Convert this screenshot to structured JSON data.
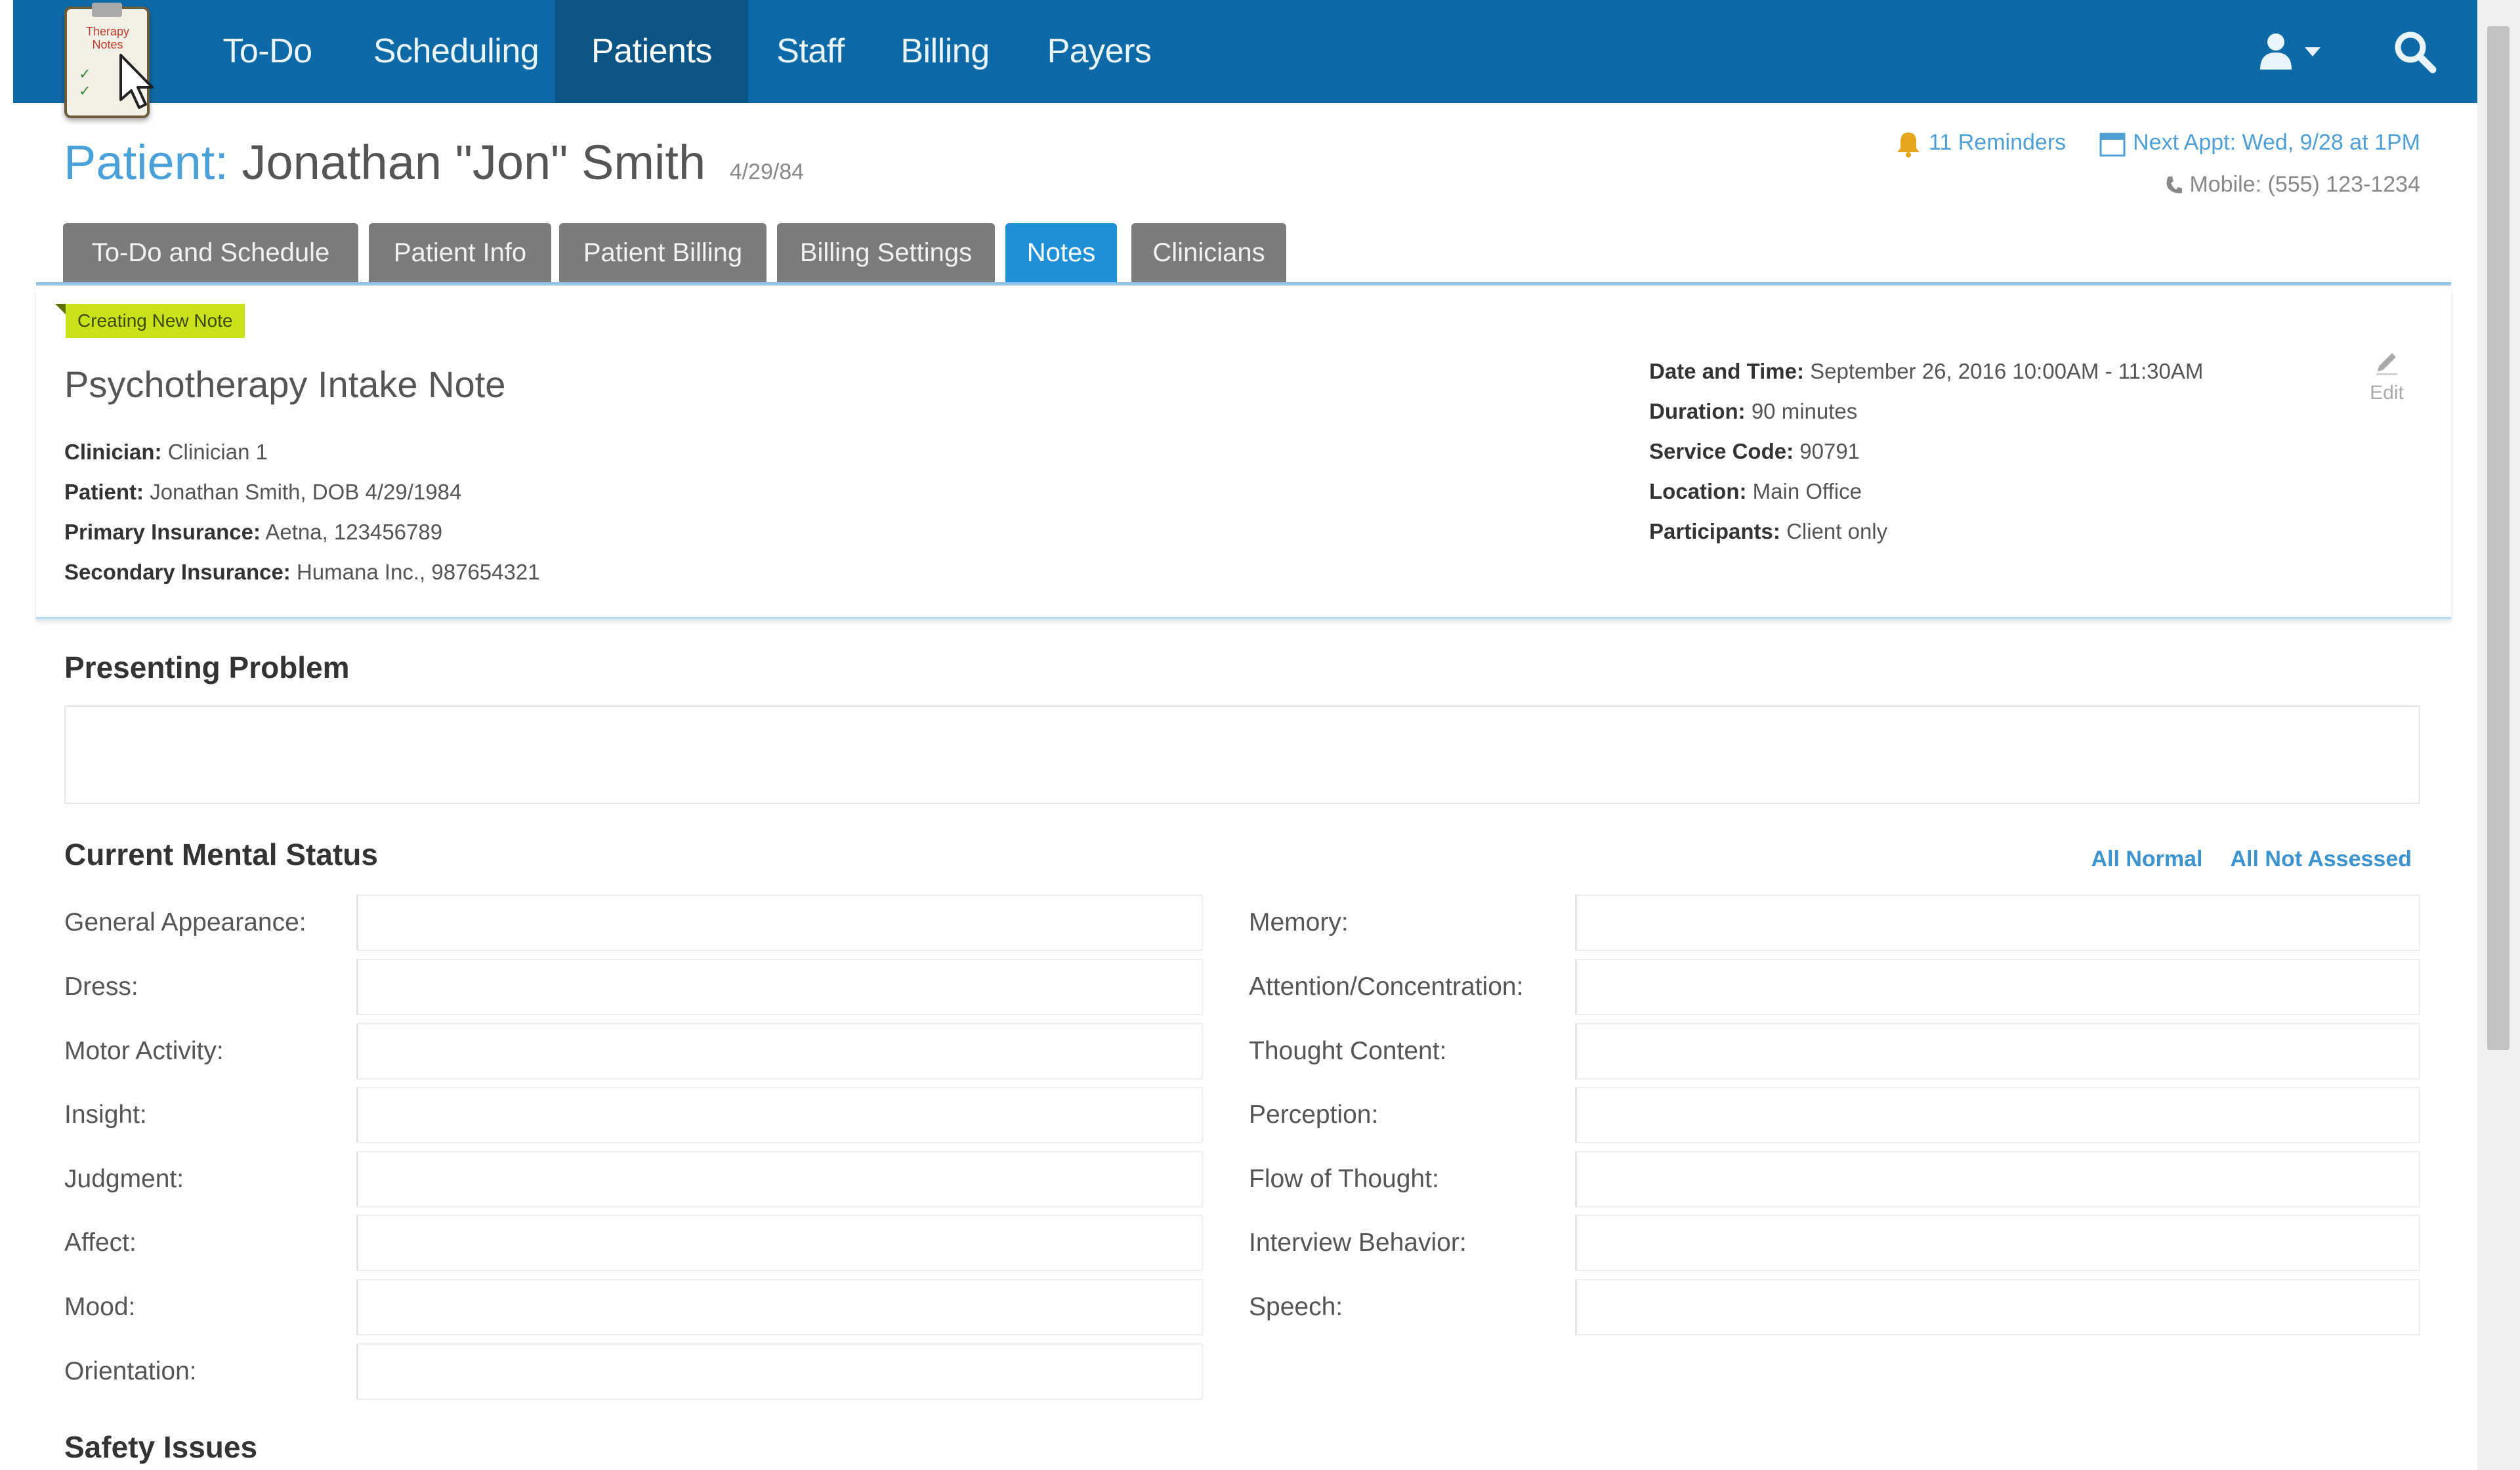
{
  "navbar": {
    "logo_text": "Therapy Notes",
    "items": [
      "To-Do",
      "Scheduling",
      "Patients",
      "Staff",
      "Billing",
      "Payers"
    ],
    "active": "Patients",
    "user_icon": "user-icon",
    "search_icon": "search-icon"
  },
  "patient": {
    "label": "Patient:",
    "name": "Jonathan \"Jon\" Smith",
    "dob_short": "4/29/84",
    "reminders": "11 Reminders",
    "next_appt": "Next Appt: Wed, 9/28 at 1PM",
    "mobile": "Mobile: (555) 123-1234"
  },
  "tabs": [
    "To-Do and Schedule",
    "Patient Info",
    "Patient Billing",
    "Billing Settings",
    "Notes",
    "Clinicians"
  ],
  "active_tab": "Notes",
  "note": {
    "badge": "Creating New Note",
    "title": "Psychotherapy Intake Note",
    "clinician_label": "Clinician:",
    "clinician": "Clinician 1",
    "patient_label": "Patient:",
    "patient": "Jonathan Smith, DOB 4/29/1984",
    "primary_label": "Primary Insurance:",
    "primary": "Aetna, 123456789",
    "secondary_label": "Secondary Insurance:",
    "secondary": "Humana Inc., 987654321",
    "datetime_label": "Date and Time:",
    "datetime": "September 26, 2016 10:00AM - 11:30AM",
    "duration_label": "Duration:",
    "duration": "90 minutes",
    "service_label": "Service Code:",
    "service": "90791",
    "location_label": "Location:",
    "location": "Main Office",
    "participants_label": "Participants:",
    "participants": "Client only",
    "edit_label": "Edit"
  },
  "presenting_problem": {
    "heading": "Presenting Problem",
    "value": ""
  },
  "mental_status": {
    "heading": "Current Mental Status",
    "all_normal": "All Normal",
    "all_not_assessed": "All Not Assessed",
    "left": [
      "General Appearance:",
      "Dress:",
      "Motor Activity:",
      "Insight:",
      "Judgment:",
      "Affect:",
      "Mood:",
      "Orientation:"
    ],
    "right": [
      "Memory:",
      "Attention/Concentration:",
      "Thought Content:",
      "Perception:",
      "Flow of Thought:",
      "Interview Behavior:",
      "Speech:"
    ]
  },
  "safety": {
    "heading": "Safety Issues"
  },
  "colors": {
    "navbar": "#0d6aa6",
    "active_tab": "#1f8fd7",
    "tab": "#7b7b7b",
    "badge": "#c9e21c",
    "link": "#3d92d0"
  }
}
